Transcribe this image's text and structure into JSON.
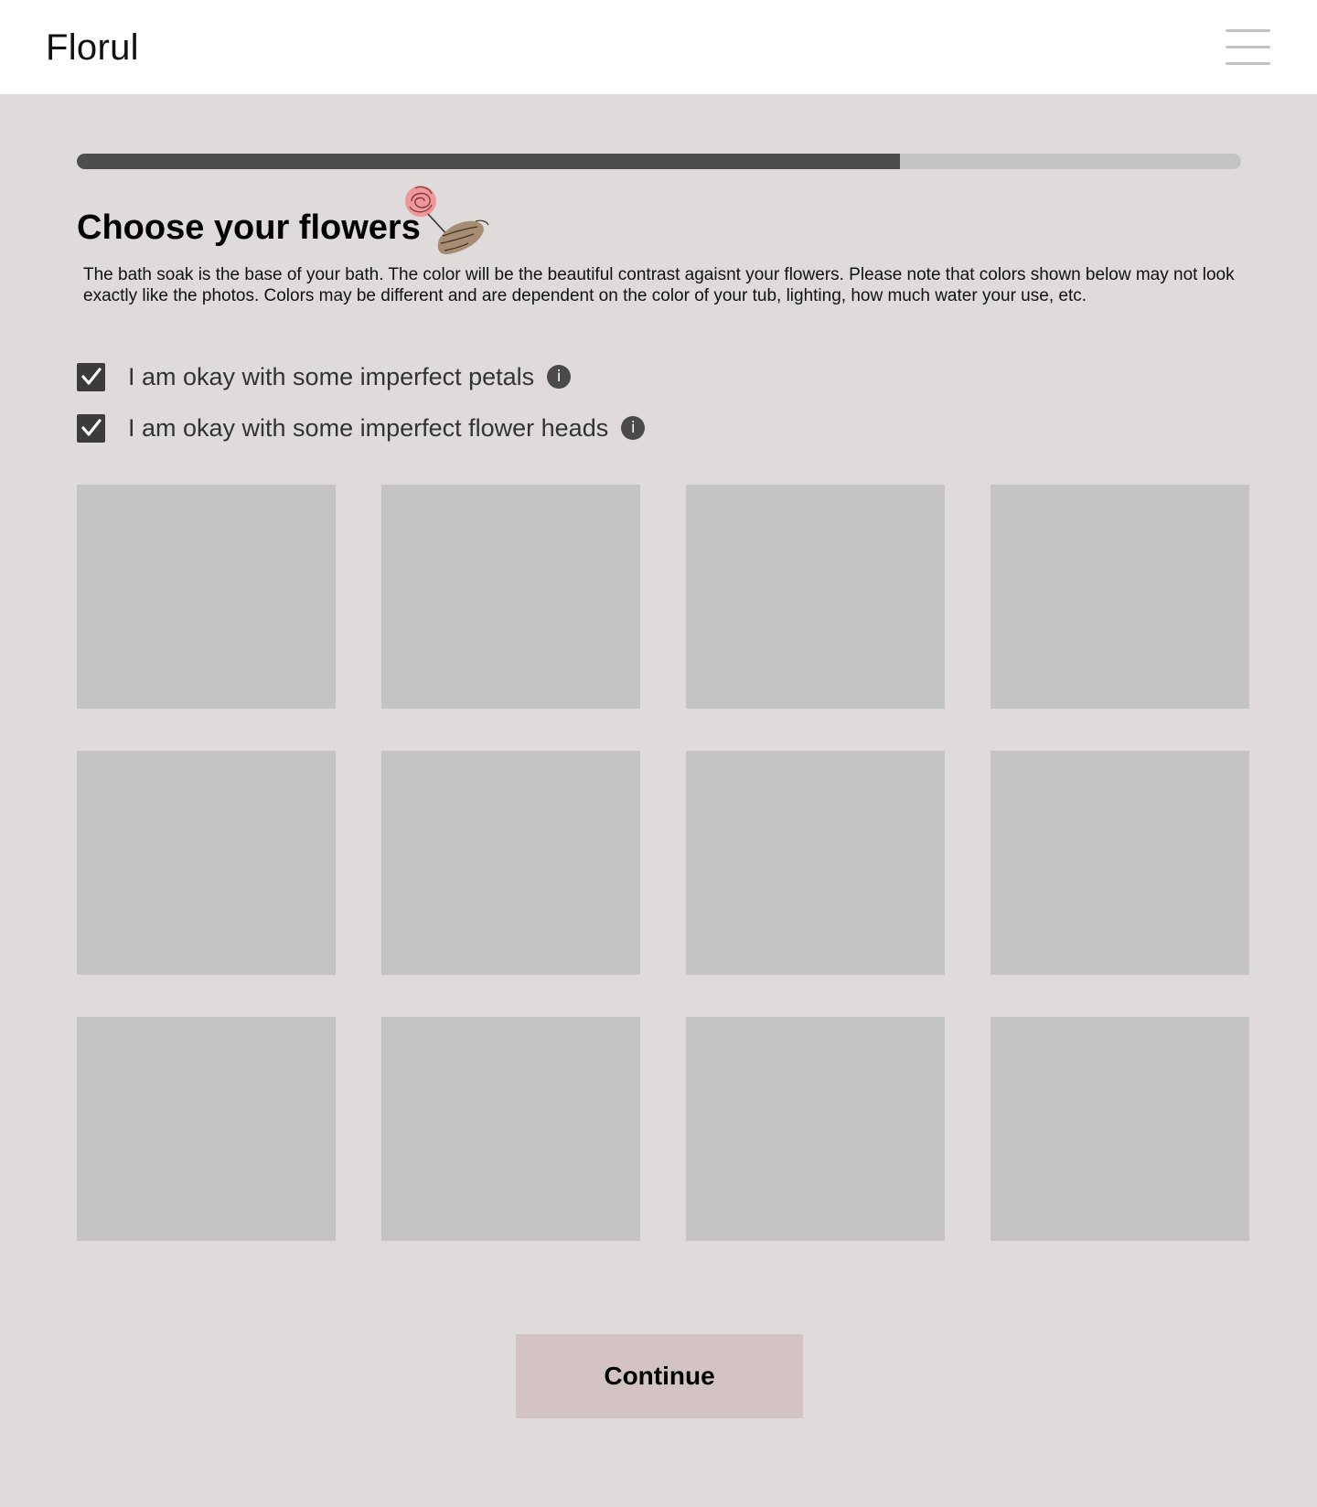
{
  "header": {
    "brand": "Florul",
    "menu_icon": "hamburger-menu-icon"
  },
  "progress": {
    "value_percent": 70.7,
    "fill_color": "#4d4d4d",
    "track_color": "#c4c4c4"
  },
  "main": {
    "title": "Choose your flowers",
    "title_icon": "rose-in-hand-icon",
    "description": "The bath soak is the base of your bath. The color will be the beautiful contrast agaisnt your flowers. Please note that colors shown below may not look exactly like the photos. Colors may be different and are dependent on the color of your tub, lighting, how much water your use, etc.",
    "options": [
      {
        "label": "I am okay with some imperfect petals",
        "checked": true,
        "info_icon": "info-icon"
      },
      {
        "label": "I am okay with some imperfect flower heads",
        "checked": true,
        "info_icon": "info-icon"
      }
    ],
    "info_glyph": "i",
    "grid": {
      "columns": 4,
      "rows": 3,
      "tile_color": "#c4c4c4"
    },
    "continue_label": "Continue",
    "continue_color": "#d4c3c3"
  },
  "colors": {
    "background": "#dfdbdb",
    "header": "#ffffff",
    "checkbox": "#3b3b3b"
  }
}
